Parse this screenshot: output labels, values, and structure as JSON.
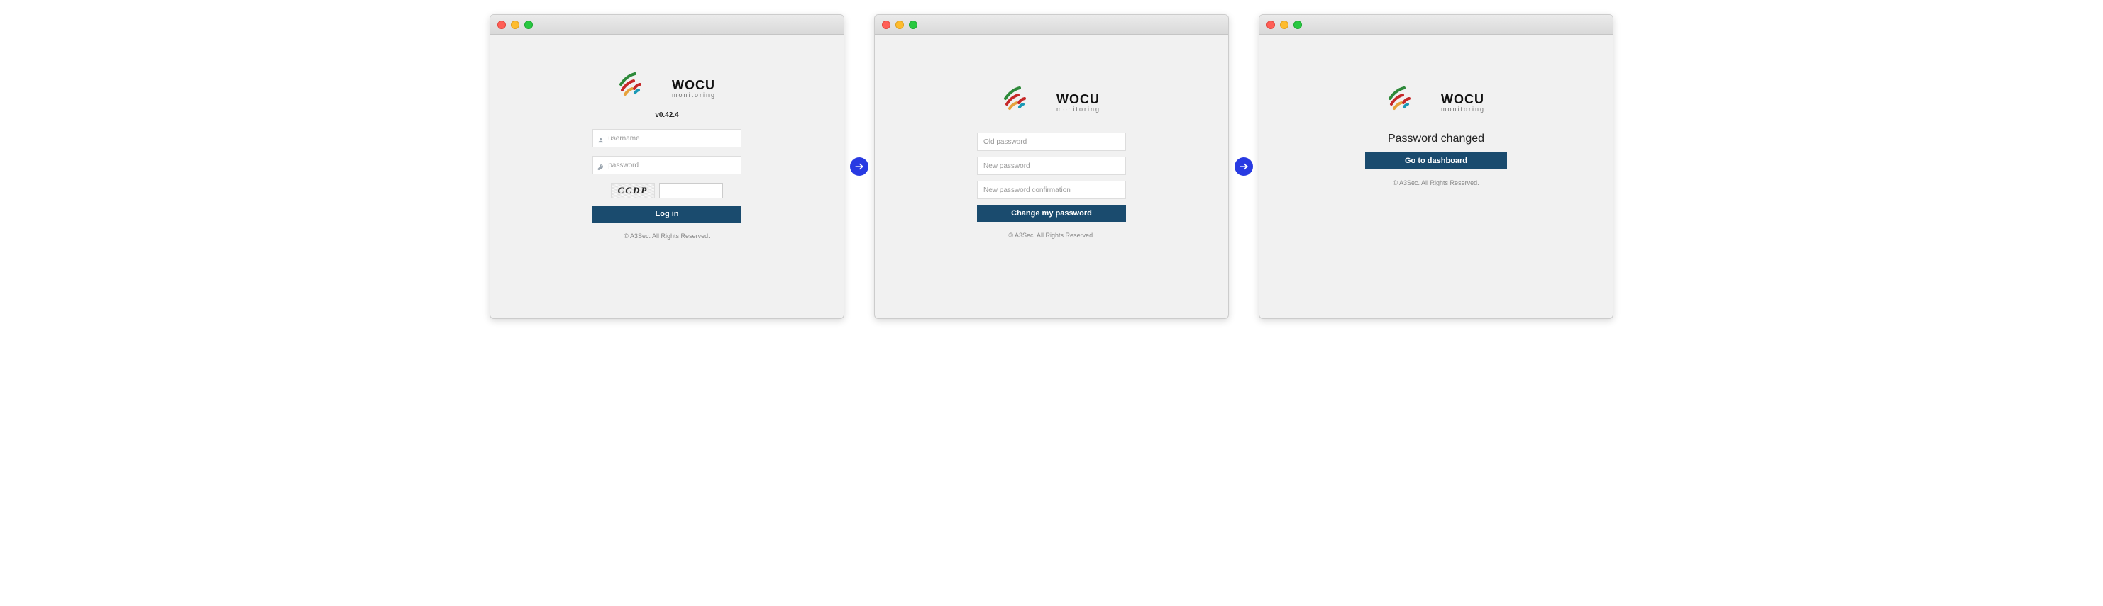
{
  "brand": {
    "name": "WOCU",
    "tagline": "monitoring"
  },
  "footer": "© A3Sec. All Rights Reserved.",
  "screen1": {
    "version": "v0.42.4",
    "username_placeholder": "username",
    "password_placeholder": "password",
    "captcha_text": "CCDP",
    "login_label": "Log in"
  },
  "screen2": {
    "old_placeholder": "Old password",
    "new_placeholder": "New password",
    "confirm_placeholder": "New password confirmation",
    "change_label": "Change my password"
  },
  "screen3": {
    "heading": "Password changed",
    "goto_label": "Go to dashboard"
  }
}
